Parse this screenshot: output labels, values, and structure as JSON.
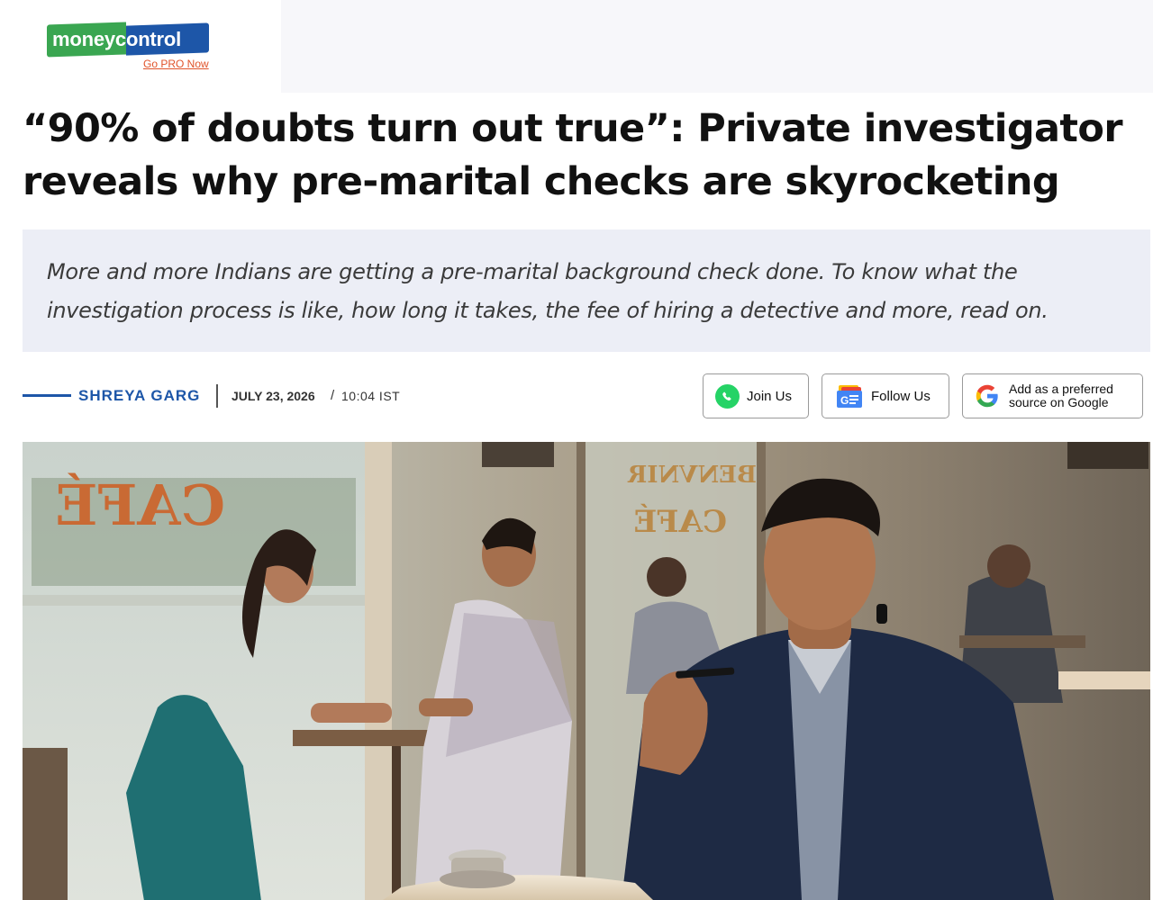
{
  "brand": {
    "logo_left": "money",
    "logo_right": "control",
    "gopro_link": "Go PRO Now",
    "colors": {
      "green": "#3aa651",
      "blue": "#1d56a8",
      "orange": "#e0532a"
    }
  },
  "article": {
    "headline": "“90% of doubts turn out true”: Private investigator reveals why pre-marital checks are skyrocketing",
    "summary": "More and more Indians are getting a pre-marital background check done. To know what the investigation process is like, how long it takes, the fee of hiring a detective and more, read on.",
    "author": "SHREYA GARG",
    "date": "JULY 23, 2026",
    "date_separator": "/",
    "time": "10:04 IST"
  },
  "social": {
    "join_label": "Join Us",
    "follow_label": "Follow Us",
    "google_label_line1": "Add as a preferred",
    "google_label_line2": "source on Google",
    "icons": [
      "whatsapp-icon",
      "google-news-icon",
      "google-icon"
    ]
  },
  "hero_image": {
    "sign_left": "CAFÉ",
    "sign_right_top": "BENVNIR",
    "sign_right_bottom": "CAFÉ"
  }
}
